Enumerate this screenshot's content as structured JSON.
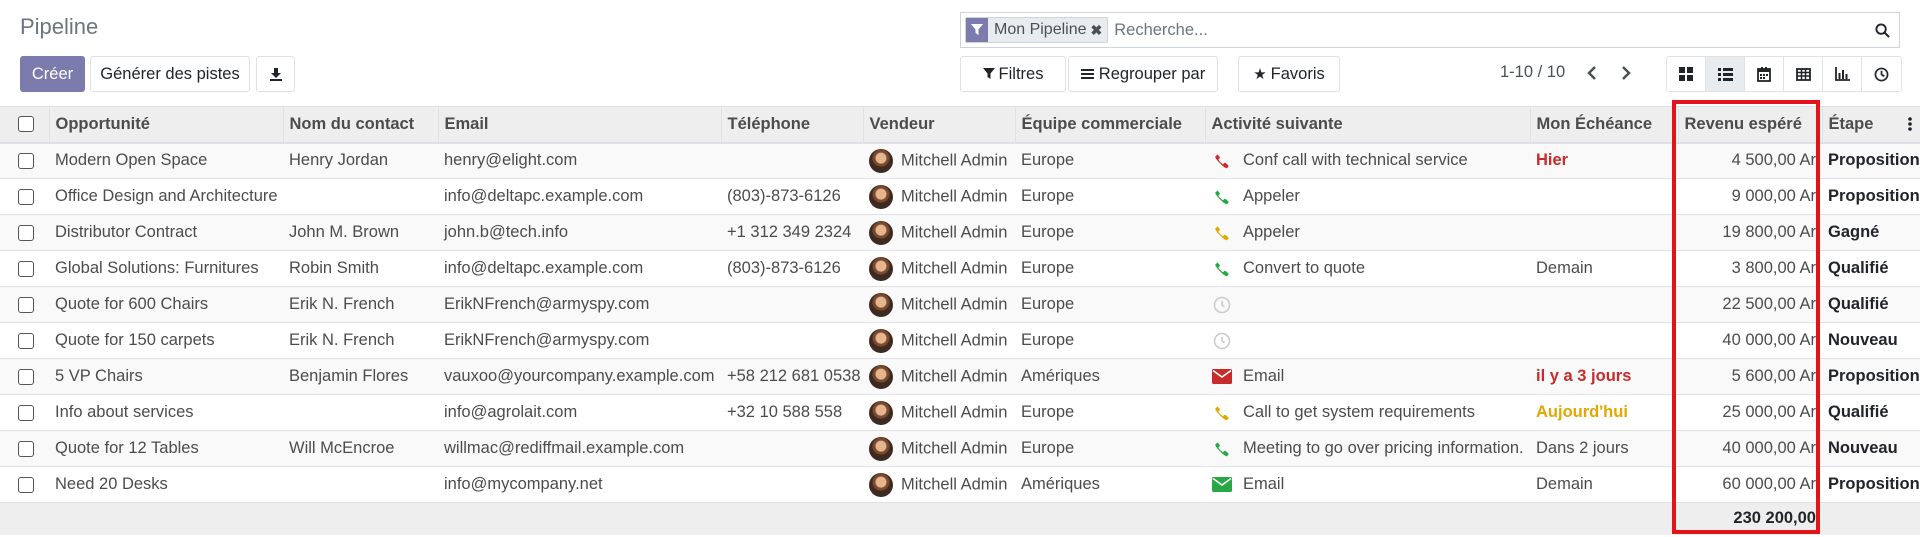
{
  "page": {
    "title": "Pipeline"
  },
  "toolbar": {
    "create_label": "Créer",
    "generate_label": "Générer des pistes",
    "filters_label": "Filtres",
    "groupby_label": "Regrouper par",
    "favorites_label": "Favoris"
  },
  "search": {
    "facet_label": "Mon Pipeline",
    "placeholder": "Recherche..."
  },
  "pager": {
    "value": "1-10 / 10"
  },
  "views": [
    "kanban-icon",
    "list-icon",
    "calendar-icon",
    "pivot-icon",
    "graph-icon",
    "activity-icon"
  ],
  "colors": {
    "primary": "#7c7bad",
    "danger": "#c92a2a",
    "warning": "#e0a800",
    "success": "#28a745",
    "highlight": "#e3131b"
  },
  "table": {
    "headers": [
      "Opportunité",
      "Nom du contact",
      "Email",
      "Téléphone",
      "Vendeur",
      "Équipe commerciale",
      "Activité suivante",
      "Mon Échéance",
      "Revenu espéré",
      "Étape"
    ],
    "rows": [
      {
        "opp": "Modern Open Space",
        "contact": "Henry Jordan",
        "email": "henry@elight.com",
        "phone": "",
        "seller": "Mitchell Admin",
        "team": "Europe",
        "activity": "Conf call with technical service",
        "activity_icon": "phone-icon",
        "activity_color": "#c92a2a",
        "deadline": "Hier",
        "deadline_state": "red",
        "revenue": "4 500,00 Ar",
        "stage": "Proposition"
      },
      {
        "opp": "Office Design and Architecture",
        "contact": "",
        "email": "info@deltapc.example.com",
        "phone": "(803)-873-6126",
        "seller": "Mitchell Admin",
        "team": "Europe",
        "activity": "Appeler",
        "activity_icon": "phone-icon",
        "activity_color": "#28a745",
        "deadline": "",
        "deadline_state": "",
        "revenue": "9 000,00 Ar",
        "stage": "Proposition"
      },
      {
        "opp": "Distributor Contract",
        "contact": "John M. Brown",
        "email": "john.b@tech.info",
        "phone": "+1 312 349 2324",
        "seller": "Mitchell Admin",
        "team": "Europe",
        "activity": "Appeler",
        "activity_icon": "phone-icon",
        "activity_color": "#e0a800",
        "deadline": "",
        "deadline_state": "",
        "revenue": "19 800,00 Ar",
        "stage": "Gagné"
      },
      {
        "opp": "Global Solutions: Furnitures",
        "contact": "Robin Smith",
        "email": "info@deltapc.example.com",
        "phone": "(803)-873-6126",
        "seller": "Mitchell Admin",
        "team": "Europe",
        "activity": "Convert to quote",
        "activity_icon": "phone-icon",
        "activity_color": "#28a745",
        "deadline": "Demain",
        "deadline_state": "",
        "revenue": "3 800,00 Ar",
        "stage": "Qualifié"
      },
      {
        "opp": "Quote for 600 Chairs",
        "contact": "Erik N. French",
        "email": "ErikNFrench@armyspy.com",
        "phone": "",
        "seller": "Mitchell Admin",
        "team": "Europe",
        "activity": "",
        "activity_icon": "clock-icon",
        "activity_color": "#cccccc",
        "deadline": "",
        "deadline_state": "",
        "revenue": "22 500,00 Ar",
        "stage": "Qualifié"
      },
      {
        "opp": "Quote for 150 carpets",
        "contact": "Erik N. French",
        "email": "ErikNFrench@armyspy.com",
        "phone": "",
        "seller": "Mitchell Admin",
        "team": "Europe",
        "activity": "",
        "activity_icon": "clock-icon",
        "activity_color": "#cccccc",
        "deadline": "",
        "deadline_state": "",
        "revenue": "40 000,00 Ar",
        "stage": "Nouveau"
      },
      {
        "opp": "5 VP Chairs",
        "contact": "Benjamin Flores",
        "email": "vauxoo@yourcompany.example.com",
        "phone": "+58 212 681 0538",
        "seller": "Mitchell Admin",
        "team": "Amériques",
        "activity": "Email",
        "activity_icon": "envelope-icon",
        "activity_color": "#c92a2a",
        "deadline": "il y a 3 jours",
        "deadline_state": "red",
        "revenue": "5 600,00 Ar",
        "stage": "Proposition"
      },
      {
        "opp": "Info about services",
        "contact": "",
        "email": "info@agrolait.com",
        "phone": "+32 10 588 558",
        "seller": "Mitchell Admin",
        "team": "Europe",
        "activity": "Call to get system requirements",
        "activity_icon": "phone-icon",
        "activity_color": "#e0a800",
        "deadline": "Aujourd'hui",
        "deadline_state": "orange",
        "revenue": "25 000,00 Ar",
        "stage": "Qualifié"
      },
      {
        "opp": "Quote for 12 Tables",
        "contact": "Will McEncroe",
        "email": "willmac@rediffmail.example.com",
        "phone": "",
        "seller": "Mitchell Admin",
        "team": "Europe",
        "activity": "Meeting to go over pricing information.",
        "activity_icon": "phone-icon",
        "activity_color": "#28a745",
        "deadline": "Dans 2 jours",
        "deadline_state": "",
        "revenue": "40 000,00 Ar",
        "stage": "Nouveau"
      },
      {
        "opp": "Need 20 Desks",
        "contact": "",
        "email": "info@mycompany.net",
        "phone": "",
        "seller": "Mitchell Admin",
        "team": "Amériques",
        "activity": "Email",
        "activity_icon": "envelope-icon",
        "activity_color": "#28a745",
        "deadline": "Demain",
        "deadline_state": "",
        "revenue": "60 000,00 Ar",
        "stage": "Proposition"
      }
    ],
    "total": "230 200,00"
  }
}
